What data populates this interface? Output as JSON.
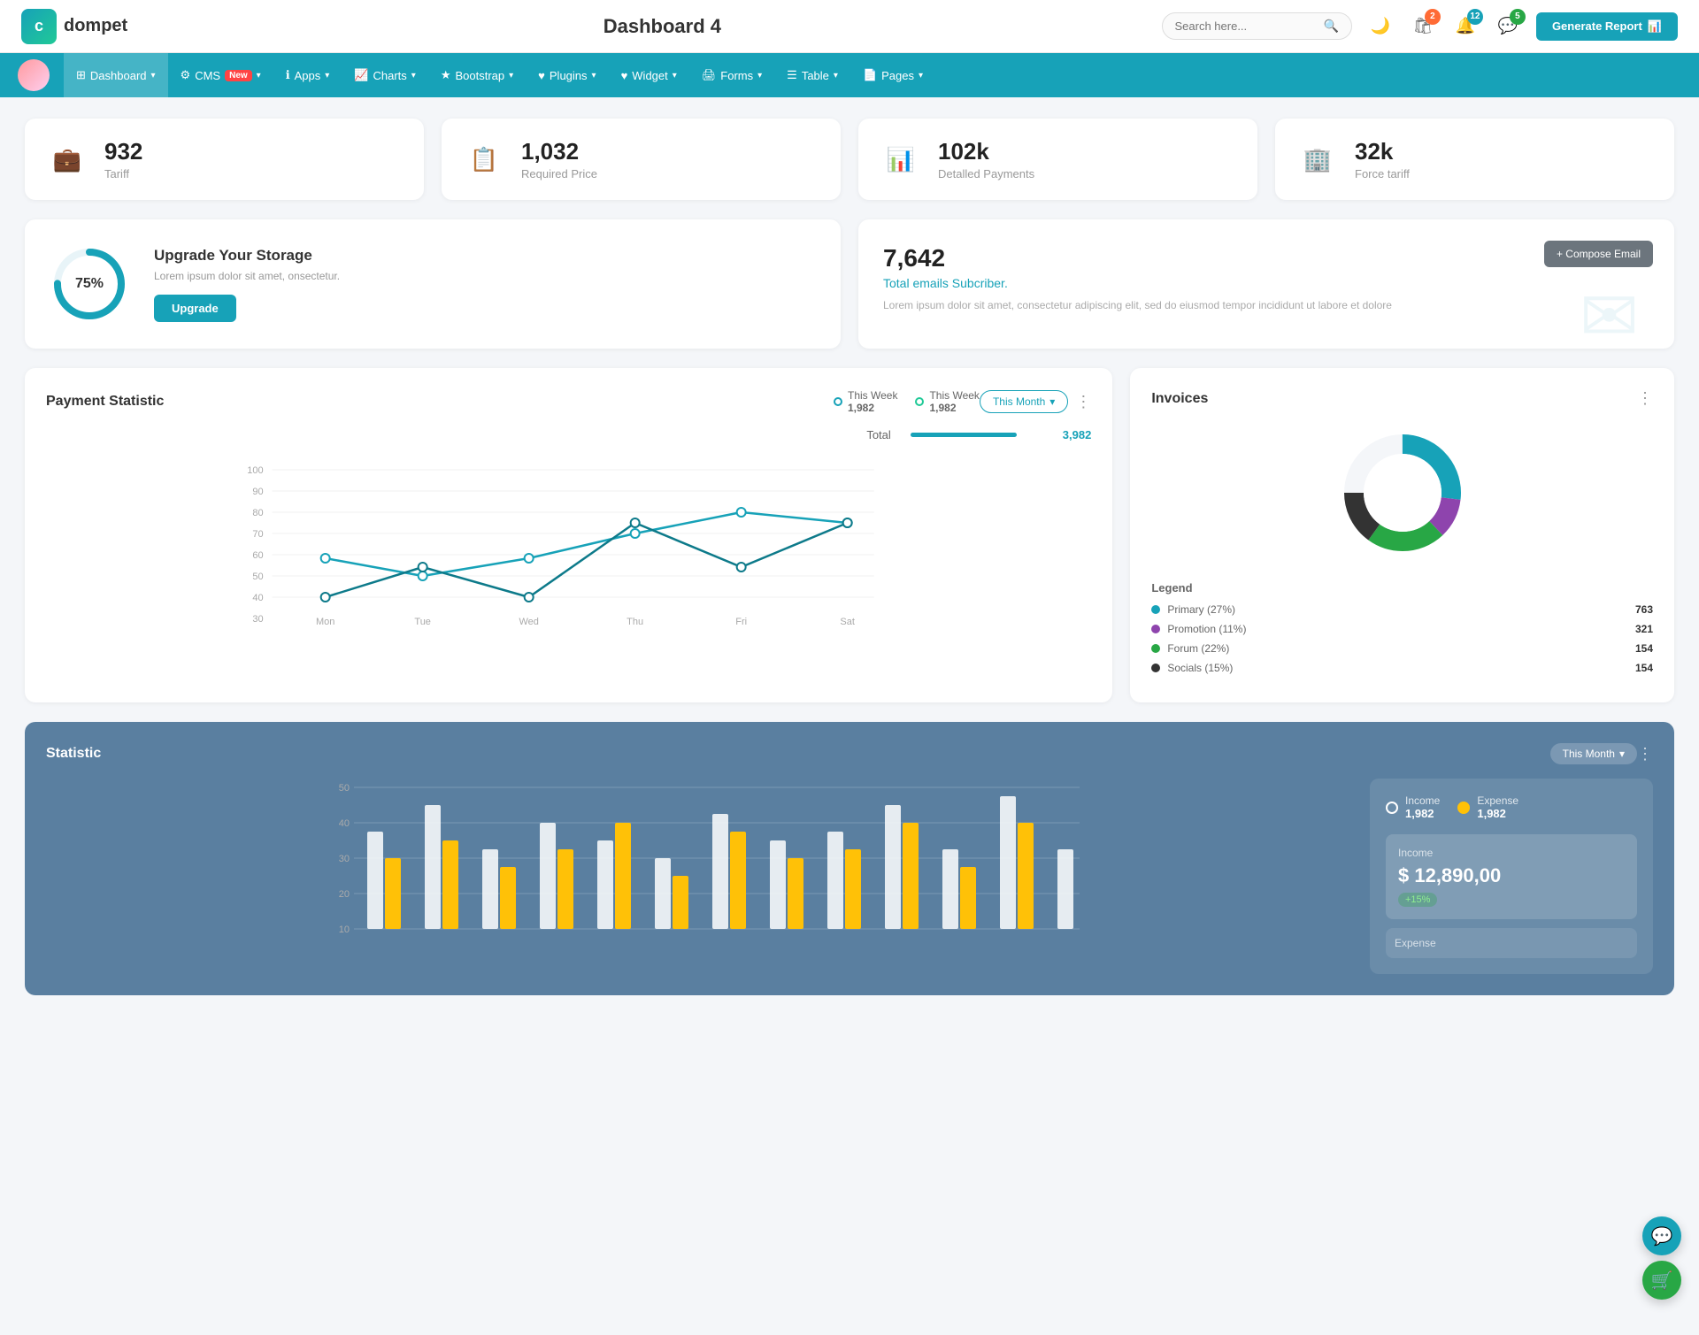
{
  "header": {
    "logo_letter": "c",
    "logo_name": "dompet",
    "page_title": "Dashboard 4",
    "search_placeholder": "Search here...",
    "generate_btn": "Generate Report",
    "badge_cart": "2",
    "badge_bell": "12",
    "badge_chat": "5"
  },
  "nav": {
    "items": [
      {
        "label": "Dashboard",
        "icon": "⊞",
        "has_arrow": true,
        "active": true
      },
      {
        "label": "CMS",
        "icon": "⚙",
        "has_arrow": true,
        "badge": "New"
      },
      {
        "label": "Apps",
        "icon": "ℹ",
        "has_arrow": true
      },
      {
        "label": "Charts",
        "icon": "📈",
        "has_arrow": true
      },
      {
        "label": "Bootstrap",
        "icon": "★",
        "has_arrow": true
      },
      {
        "label": "Plugins",
        "icon": "♥",
        "has_arrow": true
      },
      {
        "label": "Widget",
        "icon": "♥",
        "has_arrow": true
      },
      {
        "label": "Forms",
        "icon": "🖨",
        "has_arrow": true
      },
      {
        "label": "Table",
        "icon": "☰",
        "has_arrow": true
      },
      {
        "label": "Pages",
        "icon": "📄",
        "has_arrow": true
      }
    ]
  },
  "stats": [
    {
      "number": "932",
      "label": "Tariff",
      "icon": "💼",
      "color": "#17a2b8"
    },
    {
      "number": "1,032",
      "label": "Required Price",
      "icon": "📋",
      "color": "#dc3545"
    },
    {
      "number": "102k",
      "label": "Detalled Payments",
      "icon": "📊",
      "color": "#6f42c1"
    },
    {
      "number": "32k",
      "label": "Force tariff",
      "icon": "🏢",
      "color": "#e83e8c"
    }
  ],
  "storage": {
    "percent": 75,
    "title": "Upgrade Your Storage",
    "desc": "Lorem ipsum dolor sit amet, onsectetur.",
    "btn_label": "Upgrade"
  },
  "email": {
    "number": "7,642",
    "subtitle": "Total emails Subcriber.",
    "desc": "Lorem ipsum dolor sit amet, consectetur adipiscing elit, sed do eiusmod tempor incididunt ut labore et dolore",
    "compose_btn": "+ Compose Email"
  },
  "payment_chart": {
    "title": "Payment Statistic",
    "series1_label": "This Week",
    "series1_value": "1,982",
    "series2_label": "This Week",
    "series2_value": "1,982",
    "this_month_label": "This Month",
    "total_label": "Total",
    "total_value": "3,982",
    "x_labels": [
      "Mon",
      "Tue",
      "Wed",
      "Thu",
      "Fri",
      "Sat"
    ],
    "y_labels": [
      "100",
      "90",
      "80",
      "70",
      "60",
      "50",
      "40",
      "30"
    ],
    "line1_points": "60,60 130,70 220,60 310,80 400,65 490,65 580,40 670,80",
    "line2_points": "60,80 130,75 220,78 310,40 400,60 490,60 580,35 670,35"
  },
  "invoices": {
    "title": "Invoices",
    "legend": [
      {
        "label": "Primary (27%)",
        "color": "#17a2b8",
        "value": "763"
      },
      {
        "label": "Promotion (11%)",
        "color": "#8e44ad",
        "value": "321"
      },
      {
        "label": "Forum (22%)",
        "color": "#28a745",
        "value": "154"
      },
      {
        "label": "Socials (15%)",
        "color": "#333",
        "value": "154"
      }
    ],
    "legend_title": "Legend"
  },
  "statistic": {
    "title": "Statistic",
    "this_month": "This Month",
    "income_label": "Income",
    "income_value": "1,982",
    "expense_label": "Expense",
    "expense_value": "1,982",
    "income_box_label": "Income",
    "income_amount": "$ 12,890,00",
    "income_change": "+15%",
    "x_labels": [
      "",
      "",
      "",
      "",
      "",
      "",
      "",
      "",
      "",
      "",
      "",
      "",
      ""
    ],
    "y_labels": [
      "50",
      "40",
      "30",
      "20",
      "10"
    ]
  },
  "fab": {
    "support_icon": "💬",
    "cart_icon": "🛒"
  }
}
